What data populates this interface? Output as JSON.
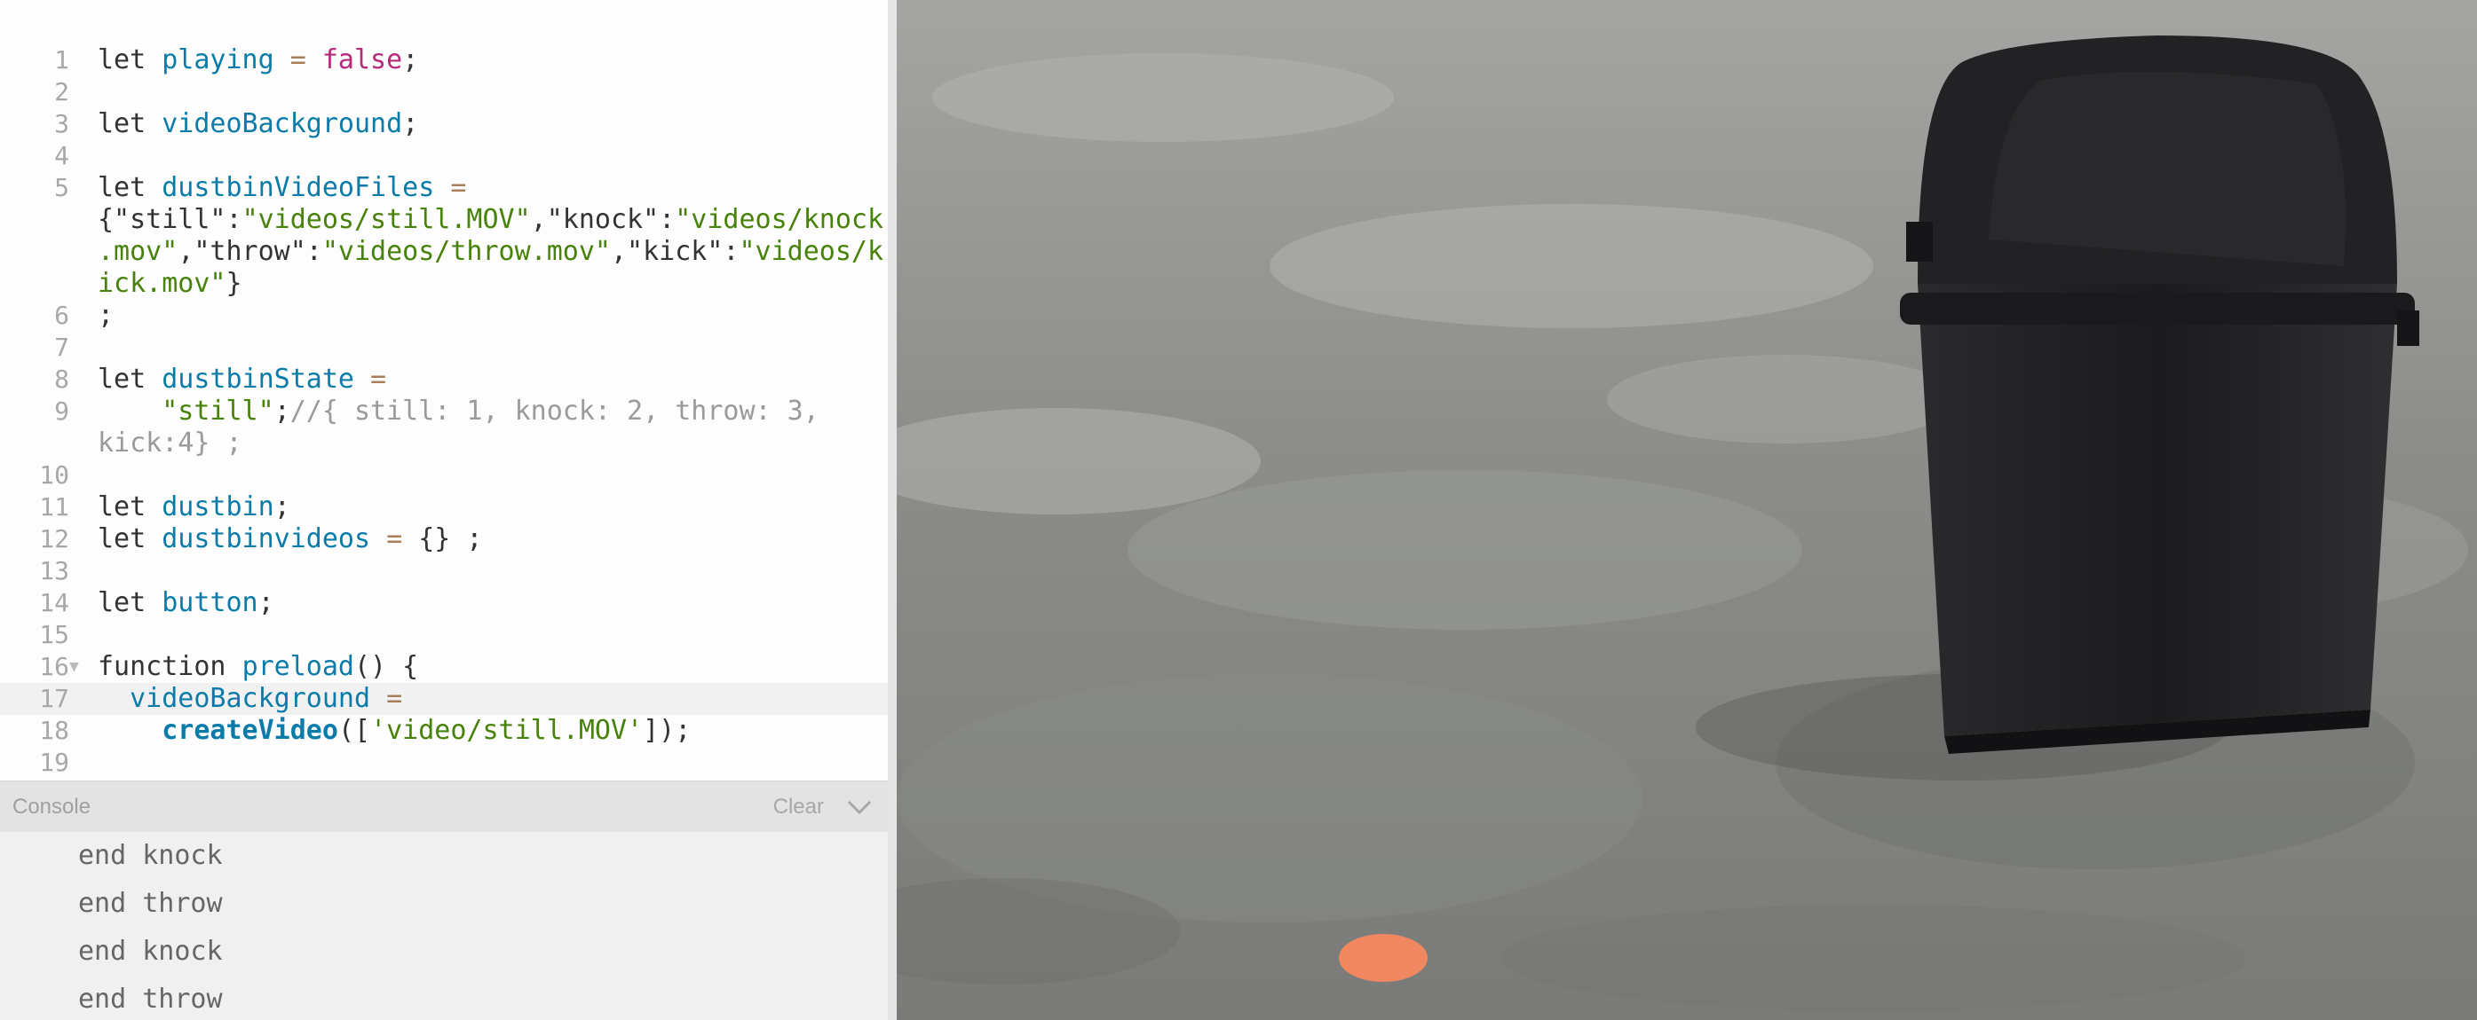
{
  "editor": {
    "lines": [
      {
        "num": "1",
        "tokens": [
          [
            "kw",
            "let "
          ],
          [
            "var",
            "playing"
          ],
          [
            "op",
            " = "
          ],
          [
            "bool",
            "false"
          ],
          [
            "p",
            ";"
          ]
        ]
      },
      {
        "num": "2",
        "tokens": []
      },
      {
        "num": "3",
        "tokens": [
          [
            "kw",
            "let "
          ],
          [
            "var",
            "videoBackground"
          ],
          [
            "p",
            ";"
          ]
        ]
      },
      {
        "num": "4",
        "tokens": []
      },
      {
        "num": "5",
        "tokens": [
          [
            "kw",
            "let "
          ],
          [
            "var",
            "dustbinVideoFiles"
          ],
          [
            "op",
            " ="
          ]
        ]
      },
      {
        "num": "",
        "tokens": [
          [
            "p",
            "{\"still\":"
          ],
          [
            "str",
            "\"videos/still.MOV\""
          ],
          [
            "p",
            ",\"knock\":"
          ],
          [
            "str",
            "\"videos/knock"
          ]
        ]
      },
      {
        "num": "",
        "tokens": [
          [
            "str",
            ".mov\""
          ],
          [
            "p",
            ",\"throw\":"
          ],
          [
            "str",
            "\"videos/throw.mov\""
          ],
          [
            "p",
            ",\"kick\":"
          ],
          [
            "str",
            "\"videos/k"
          ]
        ]
      },
      {
        "num": "",
        "tokens": [
          [
            "str",
            "ick.mov\""
          ],
          [
            "p",
            "}"
          ]
        ]
      },
      {
        "num": "6",
        "tokens": [
          [
            "p",
            ";"
          ]
        ]
      },
      {
        "num": "7",
        "tokens": []
      },
      {
        "num": "8",
        "tokens": [
          [
            "kw",
            "let "
          ],
          [
            "var",
            "dustbinState"
          ],
          [
            "op",
            " ="
          ]
        ]
      },
      {
        "num": "9",
        "tokens": [
          [
            "p",
            "    "
          ],
          [
            "str",
            "\"still\""
          ],
          [
            "p",
            ";"
          ],
          [
            "com",
            "//{ still: 1, knock: 2, throw: 3,"
          ]
        ]
      },
      {
        "num": "",
        "tokens": [
          [
            "com",
            "kick:4} ;"
          ]
        ]
      },
      {
        "num": "10",
        "tokens": []
      },
      {
        "num": "11",
        "tokens": [
          [
            "kw",
            "let "
          ],
          [
            "var",
            "dustbin"
          ],
          [
            "p",
            ";"
          ]
        ]
      },
      {
        "num": "12",
        "tokens": [
          [
            "kw",
            "let "
          ],
          [
            "var",
            "dustbinvideos"
          ],
          [
            "op",
            " = "
          ],
          [
            "p",
            "{} ;"
          ]
        ]
      },
      {
        "num": "13",
        "tokens": []
      },
      {
        "num": "14",
        "tokens": [
          [
            "kw",
            "let "
          ],
          [
            "var",
            "button"
          ],
          [
            "p",
            ";"
          ]
        ]
      },
      {
        "num": "15",
        "tokens": []
      },
      {
        "num": "16",
        "fold": "▼",
        "tokens": [
          [
            "kw",
            "function "
          ],
          [
            "var",
            "preload"
          ],
          [
            "p",
            "() {"
          ]
        ]
      },
      {
        "num": "17",
        "active": true,
        "tokens": [
          [
            "p",
            "  "
          ],
          [
            "var",
            "videoBackground"
          ],
          [
            "op",
            " ="
          ]
        ]
      },
      {
        "num": "18",
        "tokens": [
          [
            "p",
            "    "
          ],
          [
            "fn",
            "createVideo"
          ],
          [
            "p",
            "(["
          ],
          [
            "str",
            "'video/still.MOV'"
          ],
          [
            "p",
            "]);"
          ]
        ]
      },
      {
        "num": "19",
        "tokens": []
      }
    ]
  },
  "console": {
    "title": "Console",
    "clear_label": "Clear",
    "lines": [
      "end knock",
      "end throw",
      "end knock",
      "end throw"
    ]
  },
  "preview": {
    "dot_color": "#f08760",
    "bin_color": "#1c1c1e"
  }
}
